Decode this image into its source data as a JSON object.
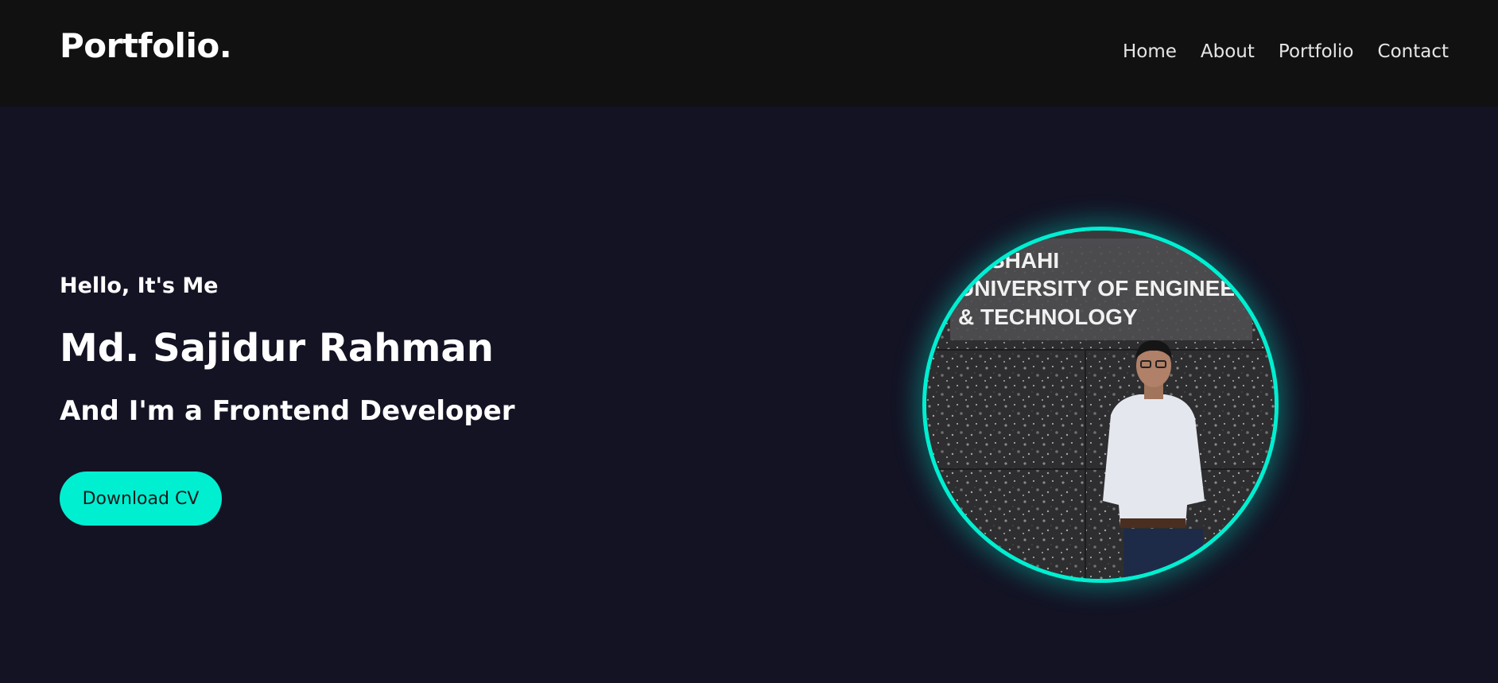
{
  "navbar": {
    "logo": "Portfolio.",
    "links": [
      {
        "label": "Home"
      },
      {
        "label": "About"
      },
      {
        "label": "Portfolio"
      },
      {
        "label": "Contact"
      }
    ]
  },
  "hero": {
    "greeting": "Hello, It's Me",
    "name": "Md. Sajidur Rahman",
    "role": "And I'm a Frontend Developer",
    "cta_label": "Download CV",
    "photo": {
      "sign_line_1": "SHAHI",
      "sign_line_2": "UNIVERSITY OF ENGINEERING",
      "sign_line_3": "& TECHNOLOGY"
    }
  },
  "colors": {
    "background": "#131324",
    "navbar": "#111111",
    "accent": "#00efd1",
    "text": "#ffffff"
  }
}
